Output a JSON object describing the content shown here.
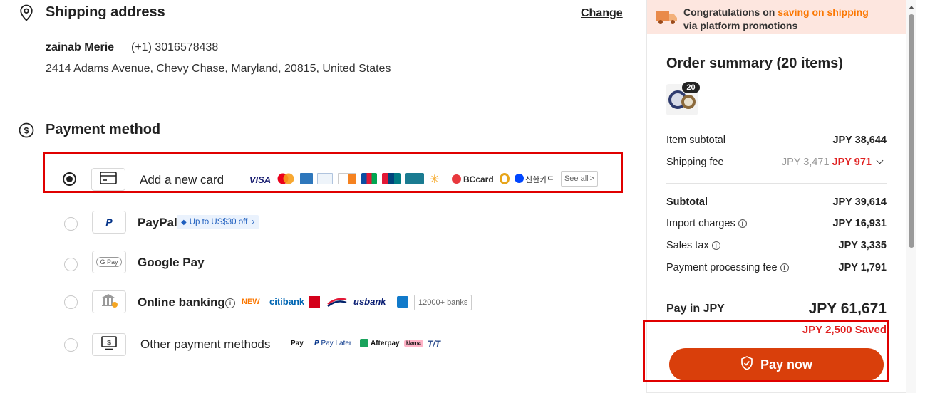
{
  "shipping": {
    "title": "Shipping address",
    "change_label": "Change",
    "name": "zainab Merie",
    "phone": "(+1) 3016578438",
    "address": "2414 Adams Avenue, Chevy Chase, Maryland, 20815, United States"
  },
  "payment": {
    "title": "Payment method",
    "options": [
      {
        "label": "Add a new card",
        "selected": true
      },
      {
        "label": "PayPal",
        "promo": "Up to US$30 off"
      },
      {
        "label": "Google Pay"
      },
      {
        "label": "Online banking",
        "new_badge": "NEW",
        "banks_count": "12000+ banks"
      },
      {
        "label": "Other payment methods"
      }
    ],
    "card_logos": [
      "VISA",
      "BCcard",
      "신한카드"
    ],
    "see_all": "See all",
    "bank_logos": [
      "citibank",
      "usbank"
    ],
    "other_logos": [
      "Pay",
      "Pay Later",
      "Afterpay",
      "Klarna",
      "T/T"
    ],
    "gpay_text": "G Pay"
  },
  "banner": {
    "text_prefix": "Congratulations on",
    "text_highlight": "saving on shipping",
    "text_suffix": "via platform promotions",
    "highlight_color": "#fb7701"
  },
  "summary": {
    "title": "Order summary (20 items)",
    "item_count_badge": "20",
    "item_subtotal_label": "Item subtotal",
    "item_subtotal_value": "JPY 38,644",
    "shipping_fee_label": "Shipping fee",
    "shipping_fee_original": "JPY 3,471",
    "shipping_fee_value": "JPY 971",
    "subtotal_label": "Subtotal",
    "subtotal_value": "JPY 39,614",
    "import_label": "Import charges",
    "import_value": "JPY 16,931",
    "sales_tax_label": "Sales tax",
    "sales_tax_value": "JPY 3,335",
    "processing_label": "Payment processing fee",
    "processing_value": "JPY 1,791",
    "pay_in_prefix": "Pay in",
    "pay_in_currency": "JPY",
    "total_value": "JPY 61,671",
    "saved_text": "JPY 2,500 Saved",
    "pay_now_label": "Pay now"
  },
  "colors": {
    "accent": "#d93f0b",
    "saved_red": "#e02020",
    "highlight_box": "#e00000",
    "banner_bg": "#fde6df"
  }
}
